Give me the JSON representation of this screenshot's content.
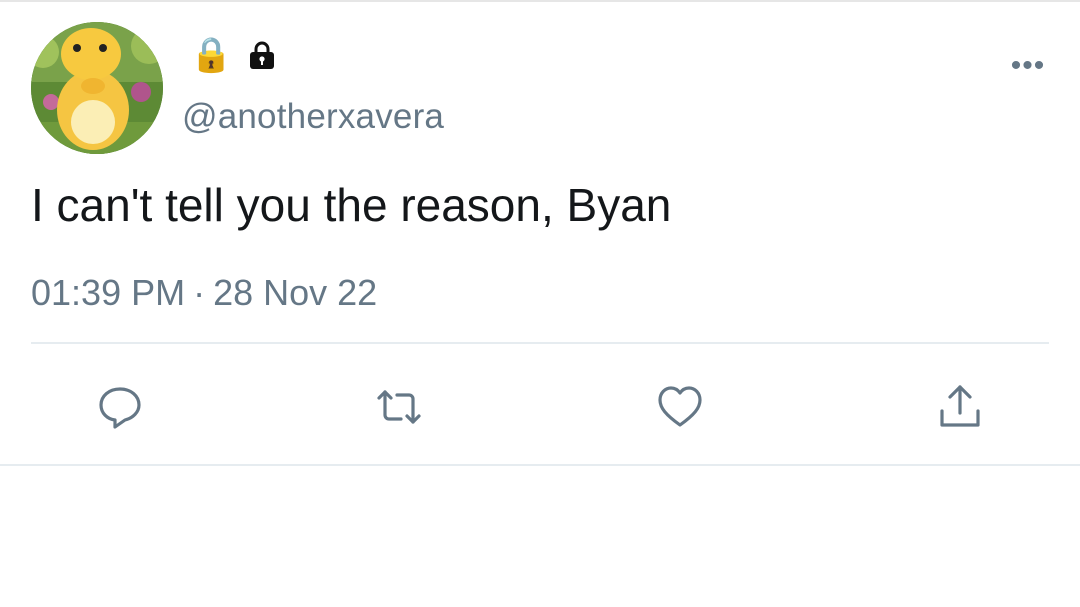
{
  "author": {
    "name_icons": [
      "🔒",
      "lock-badge-icon"
    ],
    "handle": "@anotherxavera"
  },
  "tweet": {
    "text": "I can't tell you the reason, Byan",
    "time": "01:39 PM",
    "separator": "·",
    "date": "28 Nov 22"
  },
  "menu": {
    "more_label": "•••"
  },
  "actions": [
    "reply-icon",
    "retweet-icon",
    "like-icon",
    "share-icon"
  ],
  "colors": {
    "text": "#14171a",
    "secondary": "#657786",
    "divider": "#e6ecf0"
  }
}
